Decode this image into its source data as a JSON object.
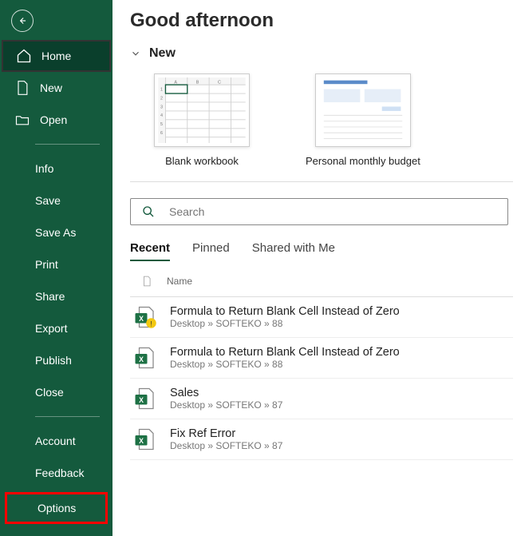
{
  "sidebar": {
    "home": "Home",
    "new": "New",
    "open": "Open",
    "info": "Info",
    "save": "Save",
    "saveAs": "Save As",
    "print": "Print",
    "share": "Share",
    "export": "Export",
    "publish": "Publish",
    "close": "Close",
    "account": "Account",
    "feedback": "Feedback",
    "options": "Options"
  },
  "main": {
    "greeting": "Good afternoon",
    "newSection": "New",
    "templates": {
      "blank": "Blank workbook",
      "budget": "Personal monthly budget"
    },
    "search": {
      "placeholder": "Search"
    },
    "tabs": {
      "recent": "Recent",
      "pinned": "Pinned",
      "shared": "Shared with Me"
    },
    "listHead": {
      "name": "Name"
    },
    "files": [
      {
        "name": "Formula to Return Blank Cell Instead of Zero",
        "path": "Desktop » SOFTEKO » 88"
      },
      {
        "name": "Formula to Return Blank Cell Instead of Zero",
        "path": "Desktop » SOFTEKO » 88"
      },
      {
        "name": "Sales",
        "path": "Desktop » SOFTEKO » 87"
      },
      {
        "name": "Fix Ref Error",
        "path": "Desktop » SOFTEKO » 87"
      }
    ]
  }
}
